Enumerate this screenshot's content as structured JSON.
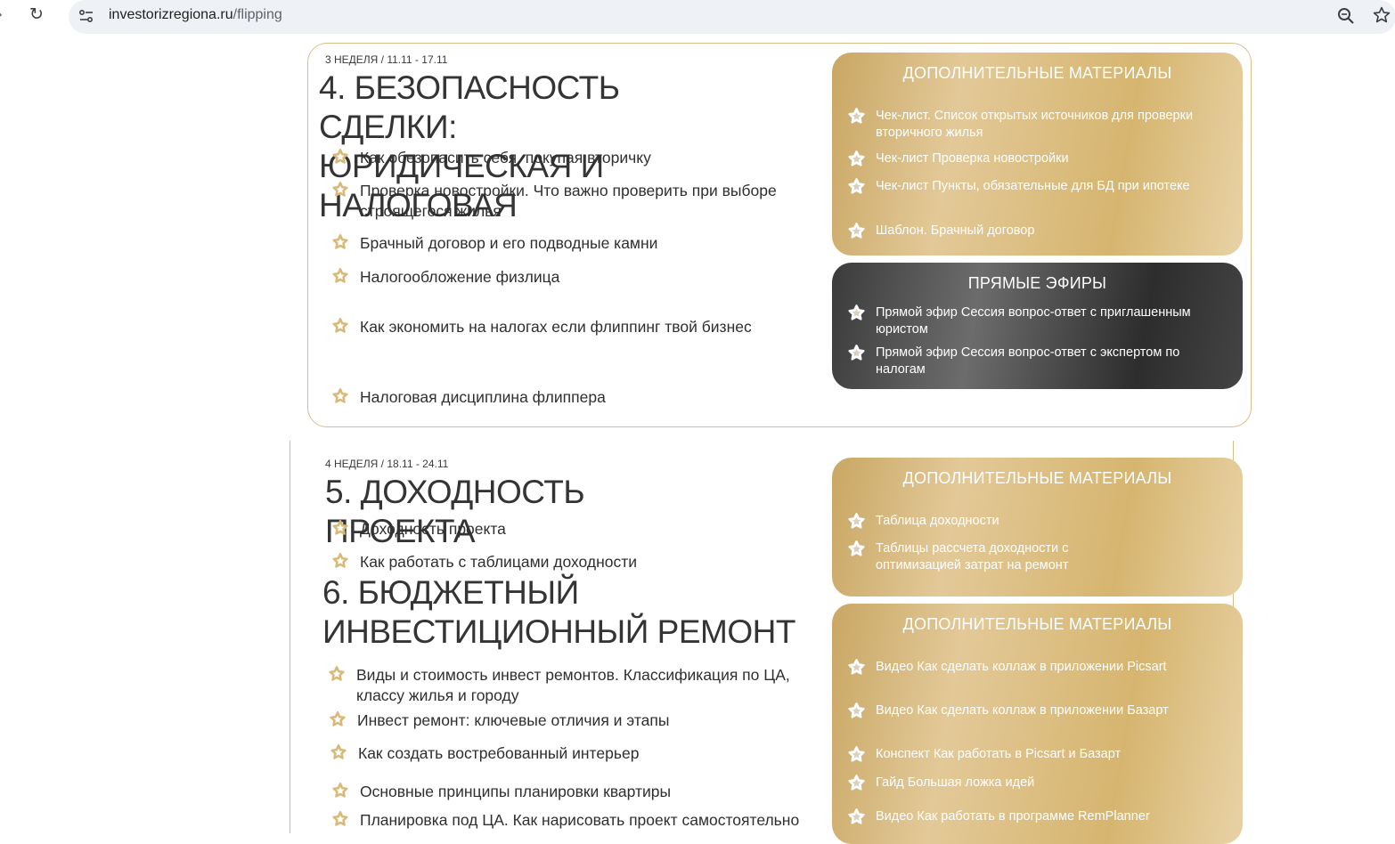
{
  "browser": {
    "url_host": "investorizregiona.ru",
    "url_path": "/flipping"
  },
  "week3": {
    "label": "3 НЕДЕЛЯ / 11.11 - 17.11",
    "title": "4. БЕЗОПАСНОСТЬ СДЕЛКИ: ЮРИДИЧЕСКАЯ И НАЛОГОВАЯ",
    "lessons": [
      "Как обезопасить себя, покупая вторичку",
      "Проверка новостройки. Что важно проверить при выборе строящегося жилья",
      "Брачный договор и его подводные камни",
      "Налогообложение физлица",
      "Как экономить на налогах если флиппинг твой бизнес",
      "Налоговая дисциплина флиппера"
    ],
    "materials_title": "ДОПОЛНИТЕЛЬНЫЕ МАТЕРИАЛЫ",
    "materials": [
      "Чек-лист. Список открытых источников для проверки вторичного жилья",
      "Чек-лист Проверка новостройки",
      "Чек-лист Пункты, обязательные для БД при ипотеке",
      "Шаблон. Брачный договор"
    ],
    "live_title": "ПРЯМЫЕ ЭФИРЫ",
    "live": [
      "Прямой эфир Сессия вопрос-ответ с приглашенным юристом",
      "Прямой эфир Сессия вопрос-ответ с экспертом по налогам"
    ]
  },
  "week4": {
    "label": "4 НЕДЕЛЯ / 18.11 - 24.11",
    "title5": "5. ДОХОДНОСТЬ ПРОЕКТА",
    "lessons5": [
      "Доходность проекта",
      "Как работать с таблицами доходности"
    ],
    "materials5_title": "ДОПОЛНИТЕЛЬНЫЕ МАТЕРИАЛЫ",
    "materials5": [
      "Таблица доходности",
      "Таблицы рассчета доходности с оптимизацией затрат на ремонт"
    ],
    "title6": "6. БЮДЖЕТНЫЙ ИНВЕСТИЦИОННЫЙ РЕМОНТ",
    "lessons6": [
      "Виды и стоимость инвест ремонтов. Классификация по ЦА, классу жилья и городу",
      "Инвест ремонт: ключевые отличия и этапы",
      "Как создать востребованный интерьер",
      "Основные принципы планировки квартиры",
      "Планировка под ЦА. Как нарисовать проект самостоятельно"
    ],
    "materials6_title": "ДОПОЛНИТЕЛЬНЫЕ МАТЕРИАЛЫ",
    "materials6": [
      "Видео Как сделать коллаж в приложении Picsart",
      "Видео Как сделать коллаж в приложении Базарт",
      "Конспект Как работать в Picsart и Базарт",
      "Гайд Большая ложка идей",
      "Видео Как работать в программе RemPlanner"
    ]
  },
  "icons": {
    "lesson_icon": "star-icon",
    "material_icon": "star-icon"
  },
  "colors": {
    "gold": "#d6b56f",
    "dark_panel": "#3b3b3b",
    "text": "#2f2f2f"
  }
}
